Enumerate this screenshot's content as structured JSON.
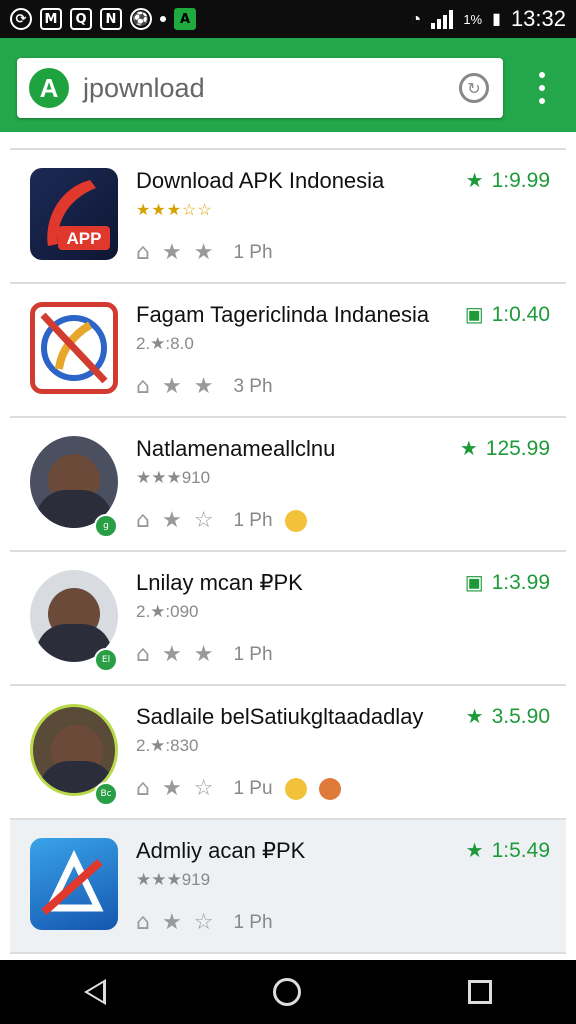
{
  "status": {
    "time": "13:32",
    "battery": "1%",
    "notification_icons": [
      "M",
      "Q",
      "N"
    ]
  },
  "search": {
    "value": "jpownload",
    "logo_letter": "A"
  },
  "apps": [
    {
      "title": "Download APK Indonesia",
      "sub": "★★★☆☆",
      "sub_style": "gold",
      "price": "1:9.99",
      "price_mark": "★",
      "votes": "1 Ph"
    },
    {
      "title": "Fagam Tagericlinda Indanesia",
      "sub": "2.★:8.0",
      "sub_style": "grey",
      "price": "1:0.40",
      "price_mark": "▣",
      "votes": "3 Ph"
    },
    {
      "title": "Natlamenameallclnu",
      "sub": "★★★910",
      "sub_style": "grey",
      "price": "125.99",
      "price_mark": "★",
      "votes": "1 Ph"
    },
    {
      "title": "Lnilay mcan ₽PK",
      "sub": "2.★:090",
      "sub_style": "grey",
      "price": "1:3.99",
      "price_mark": "▣",
      "votes": "1 Ph"
    },
    {
      "title": "Sadlaile belSatiukgltaadadlay",
      "sub": "2.★:830",
      "sub_style": "grey",
      "price": "3.5.90",
      "price_mark": "★",
      "votes": "1 Pu"
    },
    {
      "title": "Admliy acan ₽PK",
      "sub": "★★★919",
      "sub_style": "grey",
      "price": "1:5.49",
      "price_mark": "★",
      "votes": "1 Ph"
    }
  ],
  "colors": {
    "accent": "#23a74a",
    "price": "#1e9a3a"
  }
}
